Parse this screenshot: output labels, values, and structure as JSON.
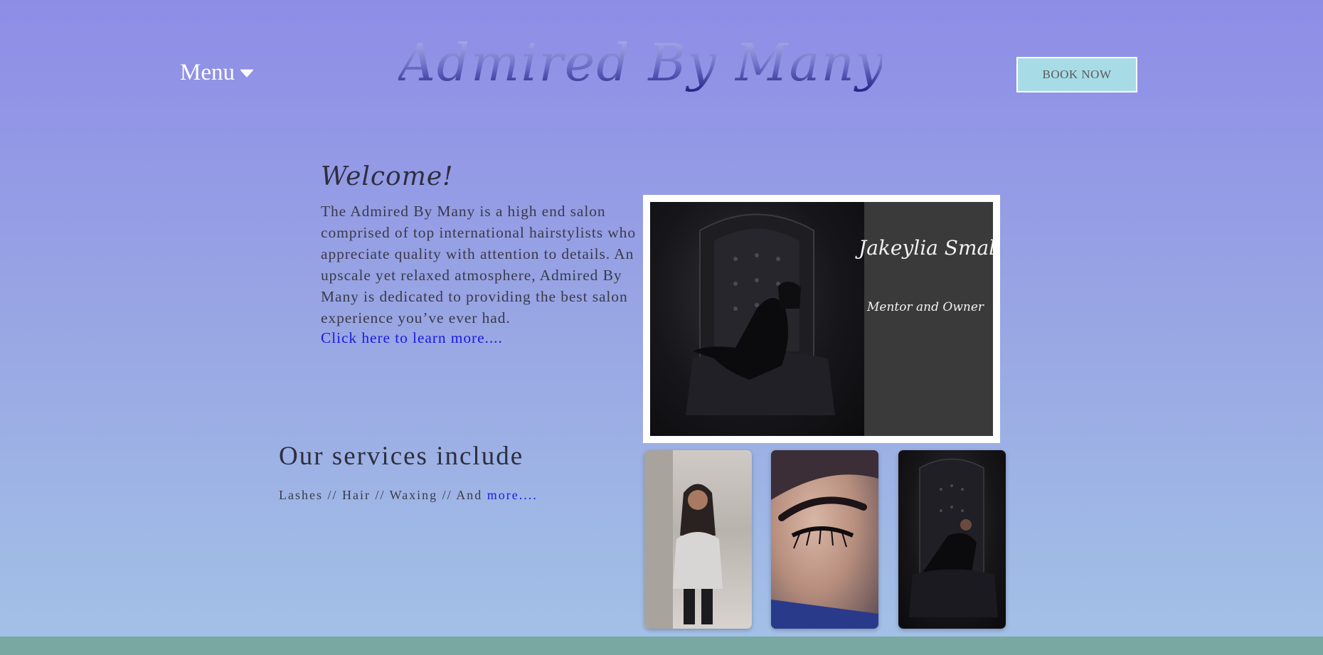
{
  "header": {
    "menu_label": "Menu",
    "logo_text": "Admired By Many",
    "book_button_label": "BOOK NOW"
  },
  "welcome": {
    "title": "Welcome!",
    "body": "The Admired By Many is a high end salon comprised of top international hairstylists who appreciate quality with attention to details. An upscale yet relaxed atmosphere, Admired By Many is dedicated to providing the best salon experience you’ve ever had.",
    "link_text": "Click here to learn more...."
  },
  "feature": {
    "name": "Jakeylia Smalls",
    "role": "Mentor and Owner"
  },
  "services": {
    "title": "Our services include",
    "list_text": "Lashes // Hair // Waxing // And ",
    "more_link": "more...."
  },
  "colors": {
    "background_top": "#8e8de6",
    "background_bottom": "#a3c2e7",
    "book_button_bg": "#a7dbe6",
    "link": "#1a1ae0",
    "footer_band": "#79a7a2"
  },
  "icons": {
    "menu_chevron": "chevron-down-icon"
  }
}
